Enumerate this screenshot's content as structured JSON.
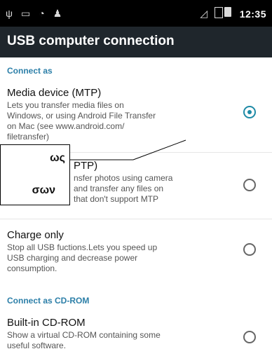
{
  "status_bar": {
    "time": "12:35",
    "icons": [
      "usb-icon",
      "battery-icon",
      "wifi-icon",
      "android-icon",
      "signal-icon",
      "sim-icon"
    ]
  },
  "app_bar": {
    "title": "USB computer connection"
  },
  "sections": [
    {
      "header": "Connect as"
    },
    {
      "header": "Connect as CD-ROM"
    }
  ],
  "items": [
    {
      "title": "Media device (MTP)",
      "desc_lines": [
        "Lets you transfer media files on",
        "Windows, or using Android File Transfer",
        "on Mac (see www.android.com/",
        "filetransfer)"
      ],
      "selected": true
    },
    {
      "title": "PTP)",
      "desc_lines": [
        "nsfer photos using camera",
        "and transfer any files on",
        "that don't support MTP"
      ],
      "selected": false
    },
    {
      "title": "Charge only",
      "desc_lines": [
        "Stop all USB fuctions.Lets you speed up",
        "USB charging and decrease power",
        "consumption."
      ],
      "selected": false
    },
    {
      "title": "Built-in CD-ROM",
      "desc_lines": [
        "Show a virtual CD-ROM containing some",
        "useful software."
      ],
      "selected": false
    }
  ],
  "callout": {
    "line1": "ως",
    "line2": "σων"
  },
  "colors": {
    "accent": "#1e8aa6",
    "section_header": "#2c7fa8",
    "app_bar": "#1f262c"
  }
}
